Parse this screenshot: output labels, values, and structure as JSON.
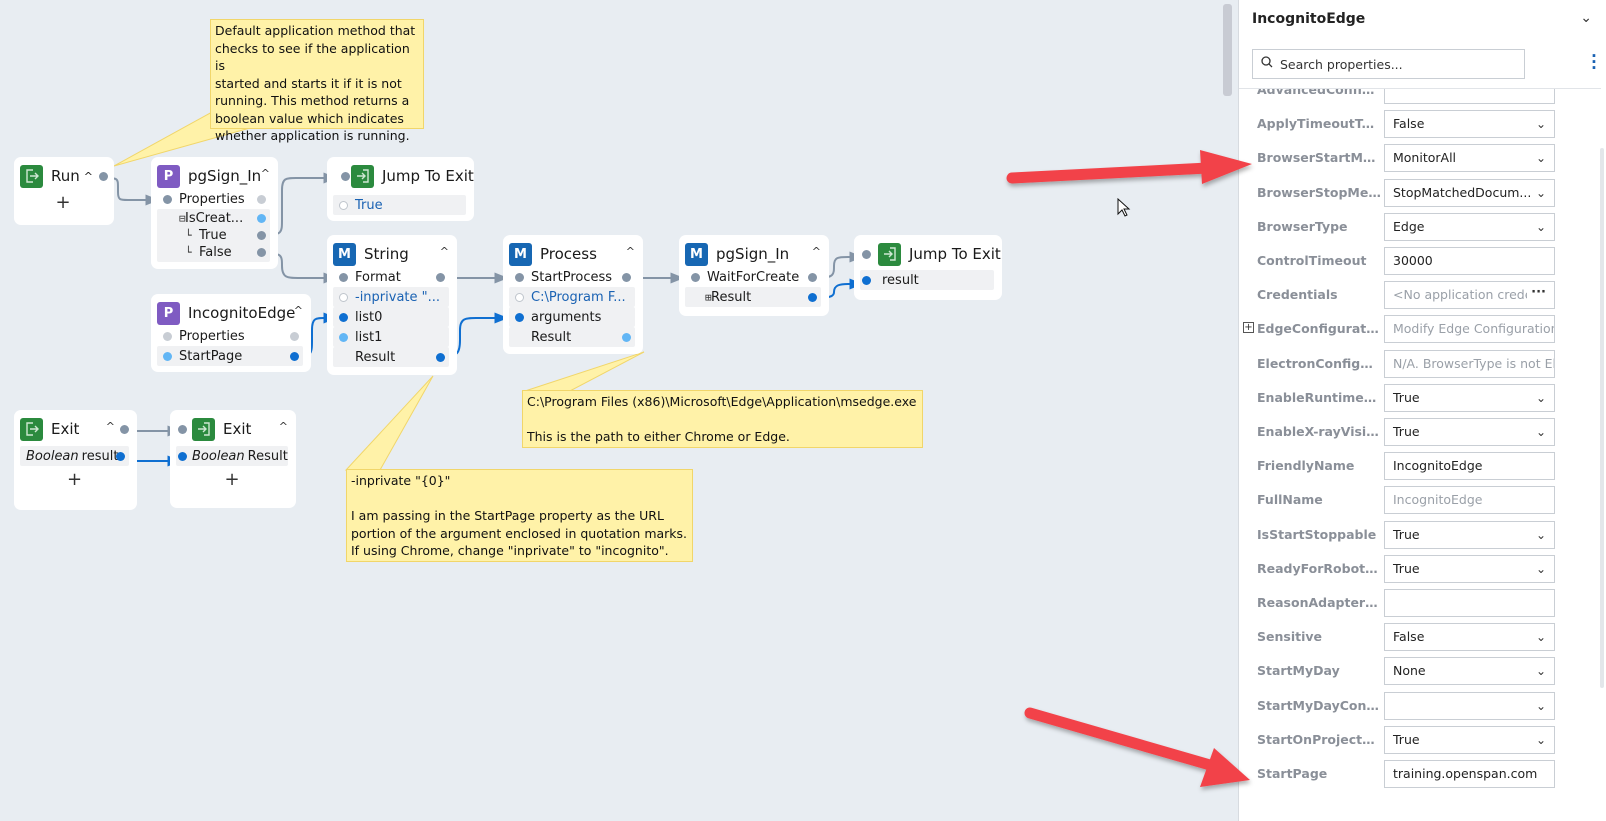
{
  "canvas": {
    "nodes": {
      "run": {
        "title": "Run",
        "badge_icon": "exit-door-icon",
        "add_label": "+"
      },
      "pgsign1": {
        "badge": "P",
        "title": "pgSign_In",
        "rows": {
          "properties": "Properties",
          "iscreated": "IsCreat...",
          "true": "True",
          "false": "False"
        }
      },
      "jump1": {
        "title": "Jump To Exit",
        "rows": {
          "value": "True"
        }
      },
      "string": {
        "badge": "M",
        "title": "String",
        "rows": {
          "format": "Format",
          "format_value": "-inprivate \"...",
          "list0": "list0",
          "list1": "list1",
          "result": "Result"
        }
      },
      "process": {
        "badge": "M",
        "title": "Process",
        "rows": {
          "startprocess": "StartProcess",
          "path_value": "C:\\Program F...",
          "arguments": "arguments",
          "result": "Result"
        }
      },
      "pgsign2": {
        "badge": "M",
        "title": "pgSign_In",
        "rows": {
          "waitforcreate": "WaitForCreate",
          "result": "Result"
        }
      },
      "jump2": {
        "title": "Jump To Exit",
        "rows": {
          "result": "result"
        }
      },
      "incognito": {
        "badge": "P",
        "title": "IncognitoEdge",
        "rows": {
          "properties": "Properties",
          "startpage": "StartPage"
        }
      },
      "exit1": {
        "title": "Exit",
        "rows": {
          "type": "Boolean",
          "name": "result"
        },
        "add_label": "+"
      },
      "exit2": {
        "title": "Exit",
        "rows": {
          "type": "Boolean",
          "name": "Result"
        },
        "add_label": "+"
      }
    },
    "notes": {
      "run_note": "Default application method that\nchecks to see if the application is\nstarted and starts it if it is not\nrunning. This method returns a\nboolean value which indicates\nwhether application is running.",
      "process_note": "C:\\Program Files (x86)\\Microsoft\\Edge\\Application\\msedge.exe\n\nThis is the path to either Chrome or Edge.",
      "string_note": "-inprivate \"{0}\"\n\nI am passing in the StartPage property as the URL\nportion of the argument enclosed in quotation marks.\nIf using Chrome, change \"inprivate\" to \"incognito\"."
    }
  },
  "panel": {
    "title": "IncognitoEdge",
    "search_placeholder": "Search properties...",
    "properties": [
      {
        "label": "AdvancedConfigu...",
        "value": "",
        "kind": "dots"
      },
      {
        "label": "ApplyTimeoutToA...",
        "value": "False",
        "kind": "select"
      },
      {
        "label": "BrowserStartMet...",
        "value": "MonitorAll",
        "kind": "select"
      },
      {
        "label": "BrowserStopMeth...",
        "value": "StopMatchedDocum...",
        "kind": "select"
      },
      {
        "label": "BrowserType",
        "value": "Edge",
        "kind": "select"
      },
      {
        "label": "ControlTimeout",
        "value": "30000",
        "kind": "text"
      },
      {
        "label": "Credentials",
        "value": "<No application crede",
        "kind": "dots-ro"
      },
      {
        "label": "EdgeConfiguration",
        "value": "Modify Edge Configuration..",
        "kind": "ro",
        "expandable": true
      },
      {
        "label": "ElectronConfigura...",
        "value": "N/A. BrowserType is not Ele",
        "kind": "ro"
      },
      {
        "label": "EnableRuntimeSel...",
        "value": "True",
        "kind": "select"
      },
      {
        "label": "EnableX-rayVision",
        "value": "True",
        "kind": "select"
      },
      {
        "label": "FriendlyName",
        "value": "IncognitoEdge",
        "kind": "text"
      },
      {
        "label": "FullName",
        "value": "IncognitoEdge",
        "kind": "ro"
      },
      {
        "label": "IsStartStoppable",
        "value": "True",
        "kind": "select"
      },
      {
        "label": "ReadyForRobotW...",
        "value": "True",
        "kind": "select"
      },
      {
        "label": "ReasonAdapterN...",
        "value": "",
        "kind": "text"
      },
      {
        "label": "Sensitive",
        "value": "False",
        "kind": "select"
      },
      {
        "label": "StartMyDay",
        "value": "None",
        "kind": "select"
      },
      {
        "label": "StartMyDayContr...",
        "value": "",
        "kind": "select"
      },
      {
        "label": "StartOnProjectStart",
        "value": "True",
        "kind": "select"
      },
      {
        "label": "StartPage",
        "value": "training.openspan.com",
        "kind": "text"
      }
    ]
  },
  "colors": {
    "canvas_bg": "#e8edf2",
    "badge_property": "#7f5bc2",
    "badge_method": "#1767b3",
    "badge_exit": "#2b8a3e",
    "wire_event": "#8494a6",
    "wire_data": "#0f6fd1",
    "note_bg": "#fff2a8",
    "annotation_arrow": "#f24349"
  }
}
